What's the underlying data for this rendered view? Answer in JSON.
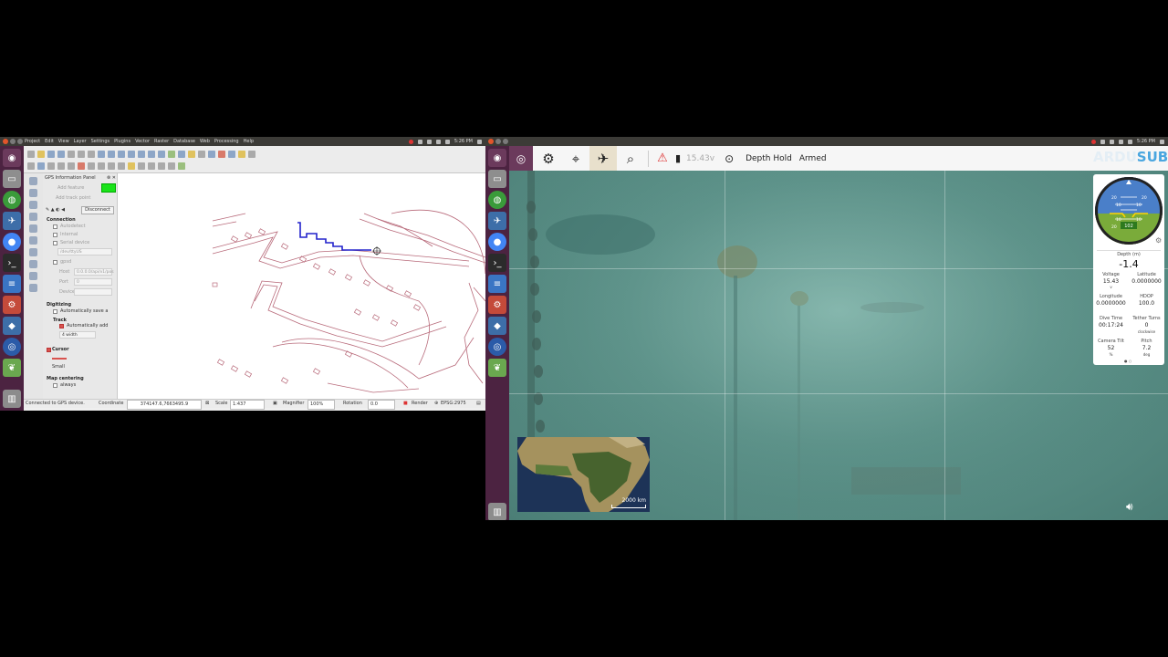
{
  "left": {
    "menus": [
      "Project",
      "Edit",
      "View",
      "Layer",
      "Settings",
      "Plugins",
      "Vector",
      "Raster",
      "Database",
      "Web",
      "Processing",
      "Help"
    ],
    "clock": "5:26 PM",
    "gps_panel": {
      "title": "GPS Information Panel",
      "add_feature": "Add feature",
      "add_track_point": "Add track point",
      "disconnect": "Disconnect",
      "connection_heading": "Connection",
      "autodetect": "Autodetect",
      "internal": "Internal",
      "serial_device": "Serial device",
      "serial_value": "/dev/ttyUS",
      "gpsd": "gpsd",
      "host_label": "Host",
      "host_value": "0.0.0.0/api/v1/pos",
      "port_label": "Port",
      "port_value": "0",
      "device_label": "Device",
      "digitizing_heading": "Digitizing",
      "auto_save": "Automatically save a",
      "track_heading": "Track",
      "auto_add": "Automatically add",
      "width_value": "4 width",
      "cursor_heading": "Cursor",
      "cursor_size": "Small",
      "map_centering_heading": "Map centering",
      "map_centering_value": "always"
    },
    "status": {
      "message": "Connected to GPS device.",
      "coordinate_label": "Coordinate",
      "coordinate_value": "374147.6,7663495.9",
      "scale_label": "Scale",
      "scale_value": "1:437",
      "magnifier_label": "Magnifier",
      "magnifier_value": "100%",
      "rotation_label": "Rotation",
      "rotation_value": "0.0",
      "render_label": "Render",
      "crs": "EPSG:2975"
    }
  },
  "right": {
    "clock": "5:26 PM",
    "toolbar": {
      "battery_voltage": "15.43v",
      "flight_mode": "Depth Hold",
      "arm_state": "Armed",
      "logo_a": "ARDU",
      "logo_b": "SUB"
    },
    "instrument": {
      "heading_value": "102",
      "depth_label": "Depth (m)",
      "depth_value": "-1.4",
      "voltage_label": "Voltage",
      "voltage_value": "15.43",
      "voltage_unit": "v",
      "latitude_label": "Latitude",
      "latitude_value": "0.0000000",
      "longitude_label": "Longitude",
      "longitude_value": "0.0000000",
      "hdop_label": "HDOP",
      "hdop_value": "100.0",
      "dive_time_label": "Dive Time",
      "dive_time_value": "00:17:24",
      "tether_label": "Tether Turns",
      "tether_value": "0",
      "tether_unit": "clockwise",
      "camera_tilt_label": "Camera Tilt",
      "camera_tilt_value": "52",
      "camera_tilt_unit": "%",
      "pitch_label": "Pitch",
      "pitch_value": "7.2",
      "pitch_unit": "deg",
      "compass_ticks": [
        "20",
        "10",
        "10",
        "20",
        "10",
        "10",
        "20"
      ]
    },
    "minimap": {
      "scale_label": "2000 km"
    }
  },
  "colors": {
    "launcher": "#4c2341",
    "gps_green": "#19e319",
    "track_blue": "#2222cc",
    "map_lines": "#b86a7a",
    "ardusub_blue": "#4aa6df"
  }
}
